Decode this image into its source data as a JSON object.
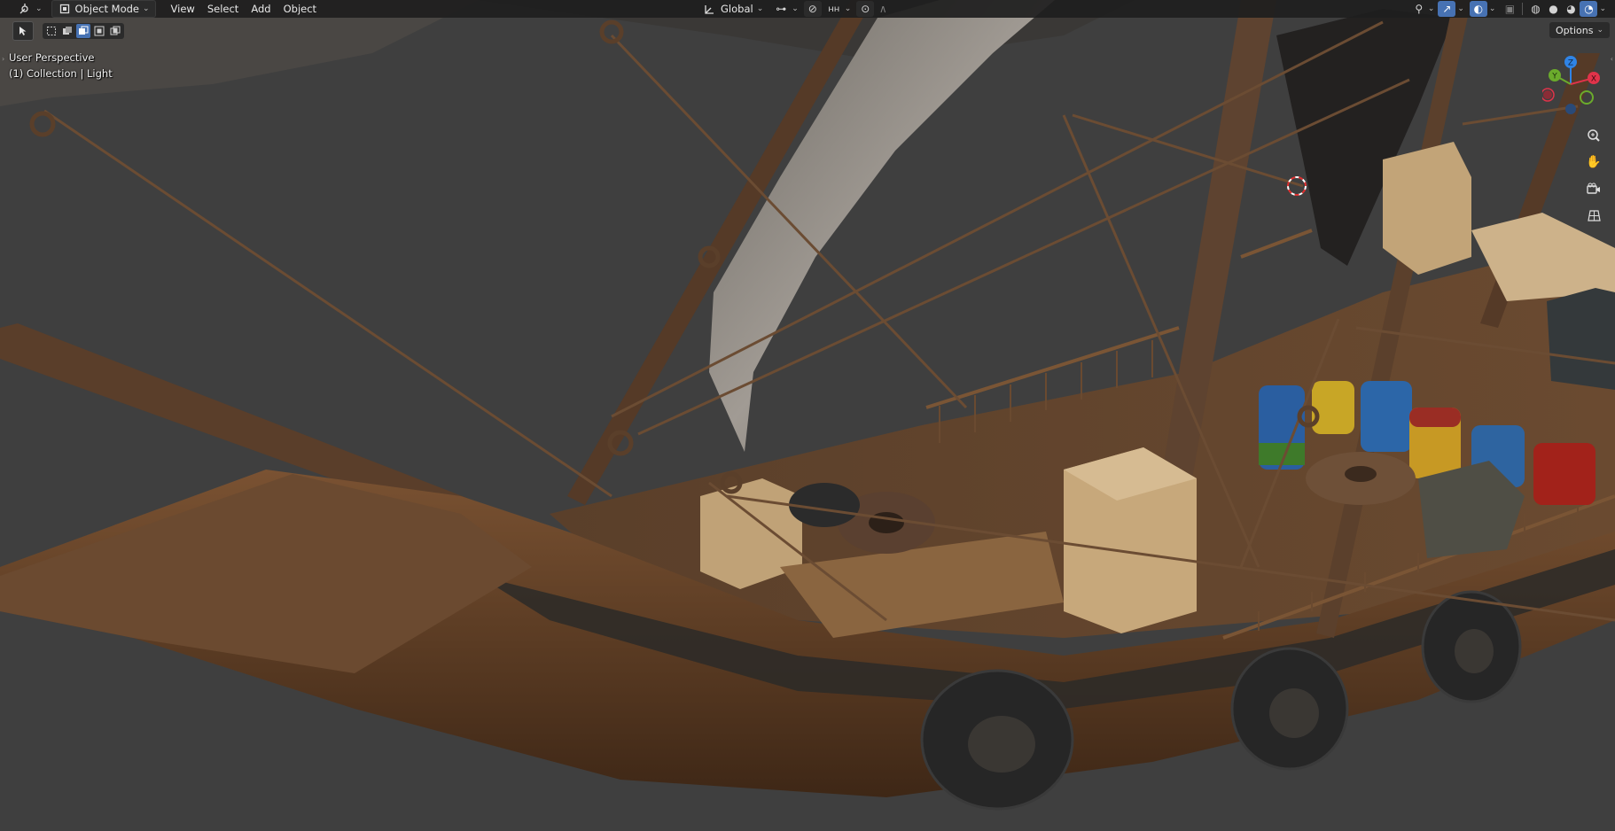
{
  "header": {
    "editor_type_icon": "3d-viewport-icon",
    "mode_label": "Object Mode",
    "menus": [
      "View",
      "Select",
      "Add",
      "Object"
    ],
    "orientation_label": "Global"
  },
  "viewport": {
    "perspective_label": "User Perspective",
    "collection_label": "(1) Collection | Light",
    "options_label": "Options"
  },
  "gizmo": {
    "axes": [
      "Z",
      "Y",
      "X"
    ],
    "colors": {
      "x": "#e0334a",
      "y": "#6bab2c",
      "z": "#2f84e6"
    }
  },
  "scene_colors": {
    "background": "#3f3f3f",
    "wood_dark": "#4a301c",
    "wood_mid": "#6e4a2d",
    "wood_light": "#8a6240",
    "sail_gray": "#8a8680",
    "sail_dark": "#2a2826",
    "crate": "#c4a77a"
  }
}
